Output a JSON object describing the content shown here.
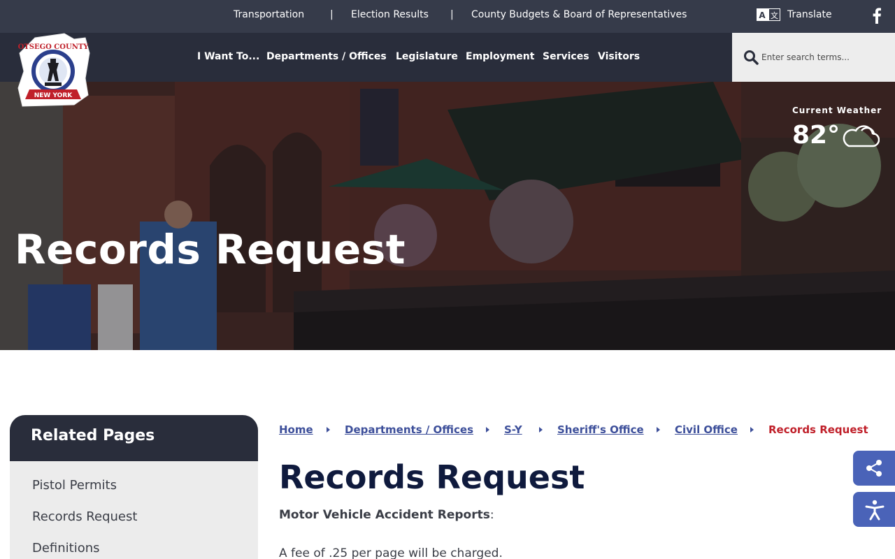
{
  "topbar": {
    "links": [
      "Transportation",
      "Election Results",
      "County Budgets & Board of Representatives"
    ],
    "separator": "|",
    "translate_label": "Translate",
    "translate_icon": "translate-icon",
    "social_icon": "facebook-icon"
  },
  "logo": {
    "line1": "OTSEGO COUNTY",
    "line2": "NEW YORK"
  },
  "nav": {
    "items": [
      "I Want To...",
      "Departments / Offices",
      "Legislature",
      "Employment",
      "Services",
      "Visitors"
    ]
  },
  "search": {
    "placeholder": "Enter search terms...",
    "value": ""
  },
  "hero": {
    "title": "Records Request",
    "weather_label": "Current Weather",
    "temperature": "82°",
    "weather_icon": "cloud-icon"
  },
  "sidebar": {
    "heading": "Related Pages",
    "items": [
      "Pistol Permits",
      "Records Request",
      "Definitions"
    ]
  },
  "breadcrumb": {
    "items": [
      "Home",
      "Departments / Offices",
      "S-Y",
      "Sheriff's Office",
      "Civil Office"
    ],
    "current": "Records Request"
  },
  "content": {
    "title": "Records Request",
    "subhead_bold": "Motor Vehicle Accident Reports",
    "subhead_rest": ":",
    "body": "A fee of .25 per page will be charged."
  },
  "fabs": {
    "share_icon": "share-icon",
    "accessibility_icon": "accessibility-icon"
  },
  "colors": {
    "topbar": "#363b4a",
    "navbar": "#292d3b",
    "breadcrumb_link": "#3d4f9a",
    "breadcrumb_current": "#c0202a",
    "title": "#0f1a3d",
    "fab": "#4a63b8"
  }
}
